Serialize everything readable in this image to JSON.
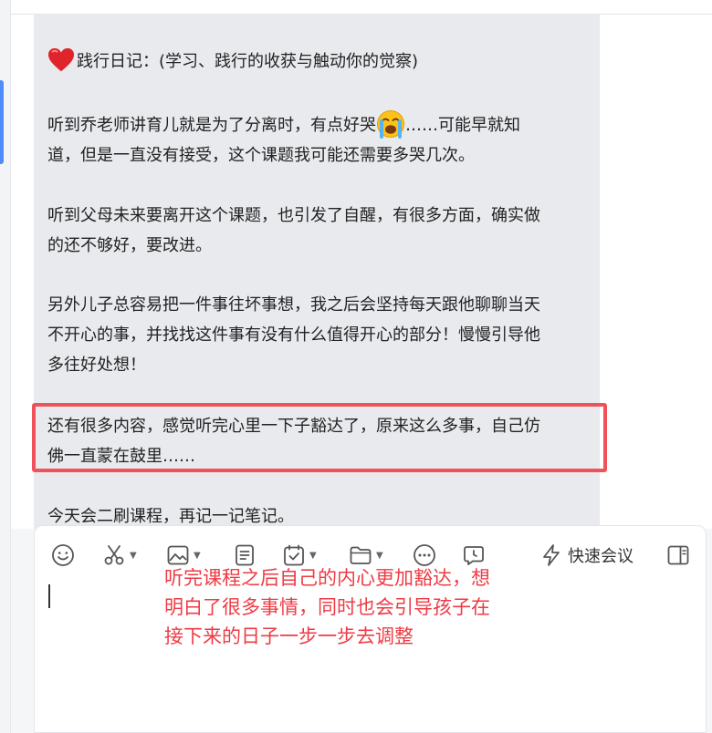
{
  "conversation": {
    "title_emoji": "heart",
    "title_text": "践行日记：(学习、践行的收获与触动你的觉察)",
    "paragraphs": [
      {
        "line1_before": "听到乔老师讲育儿就是为了分离时，有点好哭",
        "emoji": "loudly-crying-face",
        "line1_after": "……可能早就知",
        "line2": "道，但是一直没有接受，这个课题我可能还需要多哭几次。"
      },
      {
        "line1": "听到父母未来要离开这个课题，也引发了自醒，有很多方面，确实做",
        "line2": "的还不够好，要改进。"
      },
      {
        "line1": "另外儿子总容易把一件事往坏事想，我之后会坚持每天跟他聊聊当天",
        "line2": "不开心的事，并找找这件事有没有什么值得开心的部分！慢慢引导他",
        "line3": "多往好处想！"
      },
      {
        "line1": "还有很多内容，感觉听完心里一下子豁达了，原来这么多事，自己仿",
        "line2": "佛一直蒙在鼓里……"
      },
      {
        "line1": "今天会二刷课程，再记一记笔记。"
      }
    ]
  },
  "composer": {
    "toolbar": {
      "emoji_icon": "smile-icon",
      "screenshot_icon": "scissors-icon",
      "image_icon": "image-icon",
      "doc_icon": "document-icon",
      "task_icon": "checklist-icon",
      "folder_icon": "folder-icon",
      "more_icon": "more-icon",
      "schedule_icon": "calendar-clock-icon",
      "quick_meeting_label": "快速会议",
      "sidebar_icon": "sidebar-toggle-icon"
    },
    "annotation": {
      "line1": "听完课程之后自己的内心更加豁达，想",
      "line2": "明白了很多事情，同时也会引导孩子在",
      "line3": "接下来的日子一步一步去调整"
    }
  },
  "colors": {
    "bubble_bg": "#e8eaed",
    "highlight_border": "#ef5359",
    "annotation_text": "#ee3b44",
    "rail_accent": "#4f8cf7"
  }
}
